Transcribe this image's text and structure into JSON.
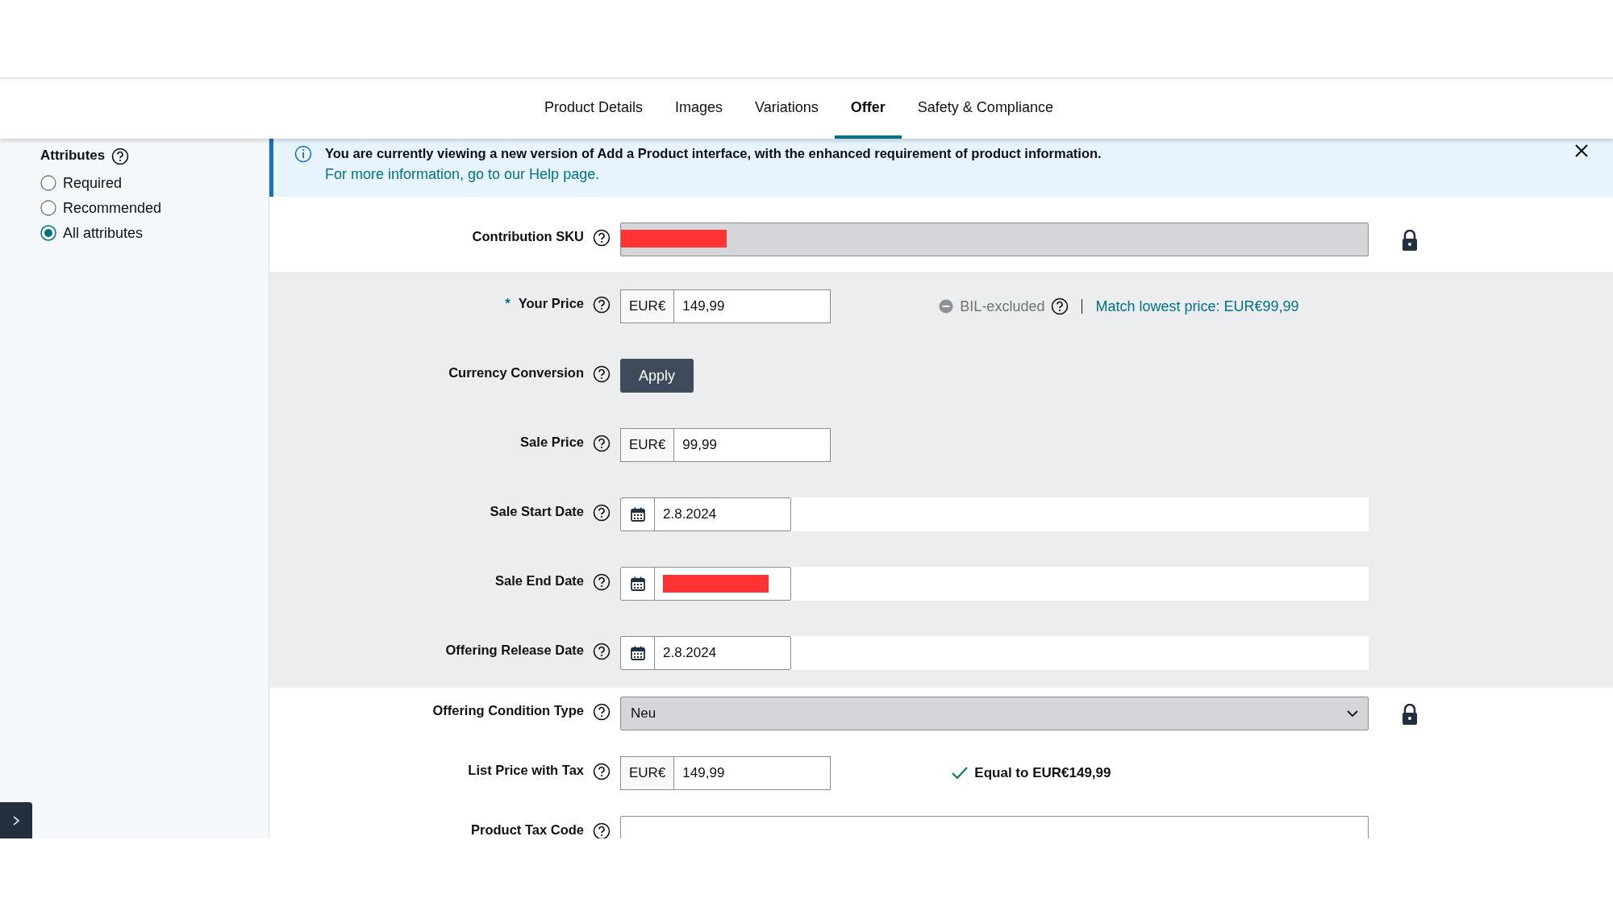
{
  "tabs": [
    {
      "label": "Product Details",
      "selected": false
    },
    {
      "label": "Images",
      "selected": false
    },
    {
      "label": "Variations",
      "selected": false
    },
    {
      "label": "Offer",
      "selected": true
    },
    {
      "label": "Safety & Compliance",
      "selected": false
    }
  ],
  "sidebar": {
    "title": "Attributes",
    "options": [
      {
        "label": "Required",
        "selected": false
      },
      {
        "label": "Recommended",
        "selected": false
      },
      {
        "label": "All attributes",
        "selected": true
      }
    ]
  },
  "banner": {
    "message": "You are currently viewing a new version of Add a Product interface, with the enhanced requirement of product information.",
    "link": "For more information, go to our Help page."
  },
  "fields": [
    {
      "kind": "text",
      "label": "Contribution SKU",
      "shaded": false,
      "locked": true,
      "redacted": true
    },
    {
      "kind": "price",
      "label": "Your Price",
      "shaded": true,
      "required_mark": "*",
      "locked": false,
      "currency": "EUR€",
      "value": "149,99",
      "status": "BIL-excluded",
      "link": "Match lowest price: EUR€99,99"
    },
    {
      "kind": "button",
      "label": "Currency Conversion",
      "shaded": true,
      "locked": false,
      "button": "Apply"
    },
    {
      "kind": "price",
      "label": "Sale Price",
      "shaded": true,
      "locked": false,
      "currency": "EUR€",
      "value": "99,99"
    },
    {
      "kind": "date",
      "label": "Sale Start Date",
      "shaded": true,
      "locked": false,
      "value": "2.8.2024"
    },
    {
      "kind": "date",
      "label": "Sale End Date",
      "shaded": true,
      "locked": false,
      "redacted": true
    },
    {
      "kind": "date",
      "label": "Offering Release Date",
      "shaded": true,
      "locked": false,
      "value": "2.8.2024"
    },
    {
      "kind": "select",
      "label": "Offering Condition Type",
      "shaded": false,
      "locked": true,
      "value": "Neu"
    },
    {
      "kind": "price",
      "label": "List Price with Tax",
      "shaded": false,
      "locked": false,
      "currency": "EUR€",
      "value": "149,99",
      "note": "Equal to EUR€149,99"
    },
    {
      "kind": "text",
      "label": "Product Tax Code",
      "shaded": false,
      "locked": false
    }
  ]
}
